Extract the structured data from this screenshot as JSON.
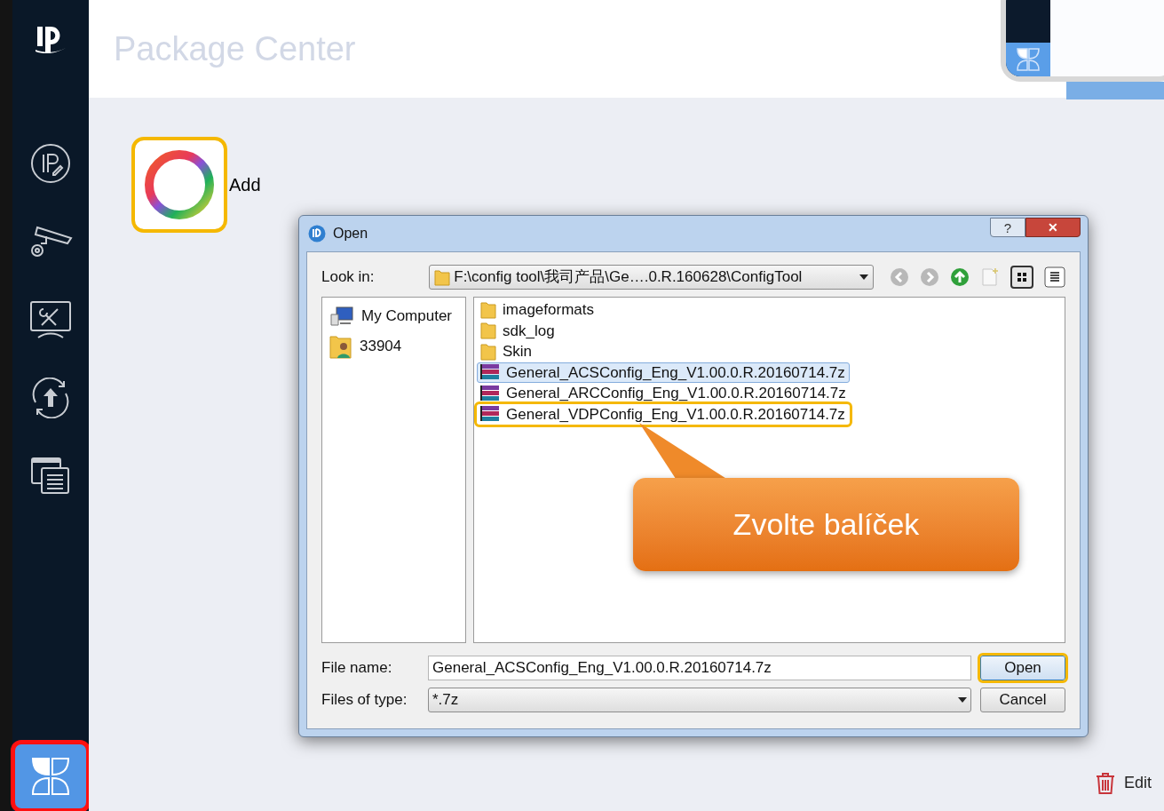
{
  "app": {
    "title": "Package Center",
    "add_label": "Add",
    "add_highlighted": true
  },
  "sidebar": {
    "items": [
      {
        "kind": "ip",
        "selected": false,
        "highlighted": false
      },
      {
        "kind": "camera",
        "selected": false,
        "highlighted": false
      },
      {
        "kind": "tools",
        "selected": false,
        "highlighted": false
      },
      {
        "kind": "upgrade",
        "selected": false,
        "highlighted": false
      },
      {
        "kind": "windows",
        "selected": false,
        "highlighted": false
      },
      {
        "kind": "packages",
        "selected": true,
        "highlighted": true
      }
    ]
  },
  "dialog": {
    "title": "Open",
    "help": "?",
    "close": "✕",
    "look_in_label": "Look in:",
    "path": "F:\\config tool\\我司产品\\Ge….0.R.160628\\ConfigTool",
    "places": [
      {
        "kind": "computer",
        "label": "My Computer"
      },
      {
        "kind": "user",
        "label": "33904"
      }
    ],
    "files": [
      {
        "kind": "folder",
        "name": "imageformats",
        "selected": false,
        "highlighted": false
      },
      {
        "kind": "folder",
        "name": "sdk_log",
        "selected": false,
        "highlighted": false
      },
      {
        "kind": "folder",
        "name": "Skin",
        "selected": false,
        "highlighted": false
      },
      {
        "kind": "archive",
        "name": "General_ACSConfig_Eng_V1.00.0.R.20160714.7z",
        "selected": true,
        "highlighted": false
      },
      {
        "kind": "archive",
        "name": "General_ARCConfig_Eng_V1.00.0.R.20160714.7z",
        "selected": false,
        "highlighted": false
      },
      {
        "kind": "archive",
        "name": "General_VDPConfig_Eng_V1.00.0.R.20160714.7z",
        "selected": false,
        "highlighted": true
      }
    ],
    "file_name_label": "File name:",
    "file_name": "General_ACSConfig_Eng_V1.00.0.R.20160714.7z",
    "file_type_label": "Files of type:",
    "file_type": "*.7z",
    "buttons": [
      {
        "label": "Open",
        "highlighted": true
      },
      {
        "label": "Cancel",
        "highlighted": false
      }
    ]
  },
  "callout": {
    "text": "Zvolte balíček"
  },
  "footer": {
    "edit_label": "Edit"
  }
}
